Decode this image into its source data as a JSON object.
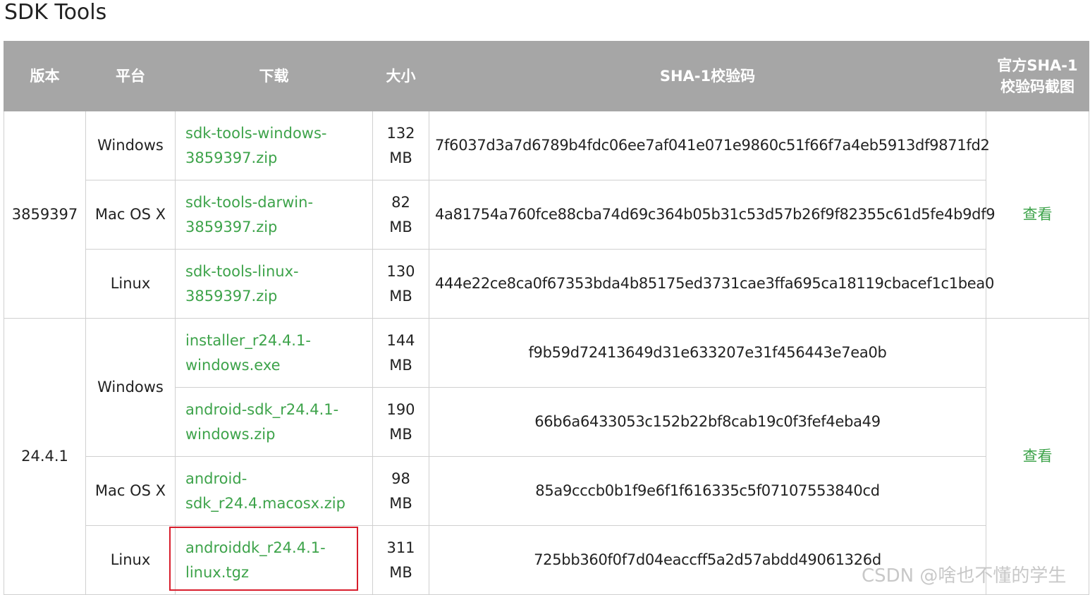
{
  "title": "SDK Tools",
  "headers": {
    "version": "版本",
    "platform": "平台",
    "download": "下载",
    "size": "大小",
    "sha1": "SHA-1校验码",
    "official_line1": "官方SHA-1",
    "official_line2": "校验码截图"
  },
  "groups": [
    {
      "version": "3859397",
      "view_link": "查看",
      "rows": [
        {
          "platform": "Windows",
          "file_line1": "sdk-tools-windows-",
          "file_line2": "3859397.zip",
          "size_num": "132",
          "size_unit": "MB",
          "sha1": "7f6037d3a7d6789b4fdc06ee7af041e071e9860c51f66f7a4eb5913df9871fd2"
        },
        {
          "platform": "Mac OS X",
          "file_line1": "sdk-tools-darwin-",
          "file_line2": "3859397.zip",
          "size_num": "82",
          "size_unit": "MB",
          "sha1": "4a81754a760fce88cba74d69c364b05b31c53d57b26f9f82355c61d5fe4b9df9"
        },
        {
          "platform": "Linux",
          "file_line1": "sdk-tools-linux-",
          "file_line2": "3859397.zip",
          "size_num": "130",
          "size_unit": "MB",
          "sha1": "444e22ce8ca0f67353bda4b85175ed3731cae3ffa695ca18119cbacef1c1bea0"
        }
      ]
    },
    {
      "version": "24.4.1",
      "view_link": "查看",
      "rows": [
        {
          "platform": "Windows",
          "file_line1": "installer_r24.4.1-",
          "file_line2": "windows.exe",
          "size_num": "144",
          "size_unit": "MB",
          "sha1": "f9b59d72413649d31e633207e31f456443e7ea0b"
        },
        {
          "platform": "",
          "file_line1": "android-sdk_r24.4.1-",
          "file_line2": "windows.zip",
          "size_num": "190",
          "size_unit": "MB",
          "sha1": "66b6a6433053c152b22bf8cab19c0f3fef4eba49"
        },
        {
          "platform": "Mac OS X",
          "file_line1": "android-",
          "file_line2": "sdk_r24.4.macosx.zip",
          "size_num": "98",
          "size_unit": "MB",
          "sha1": "85a9cccb0b1f9e6f1f616335c5f07107553840cd"
        },
        {
          "platform": "Linux",
          "file_line1": "androiddk_r24.4.1-",
          "file_line2": "linux.tgz",
          "size_num": "311",
          "size_unit": "MB",
          "sha1": "725bb360f0f7d04eaccff5a2d57abdd49061326d"
        }
      ]
    }
  ],
  "watermark": "CSDN @啥也不懂的学生",
  "colors": {
    "header_bg": "#a6a6a6",
    "link": "#3da34a",
    "highlight": "#d81e2c"
  }
}
